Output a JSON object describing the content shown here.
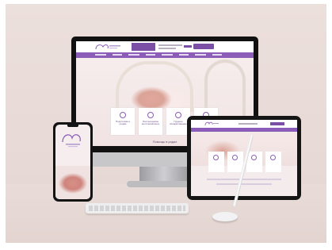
{
  "scene": "website mockup",
  "colors": {
    "wall": "#e8dbd7",
    "brand_purple": "#8b5db8",
    "device_black": "#111111"
  },
  "monitor": {
    "cards": [
      {
        "icon": "circle-icon",
        "label": "Подготовка к родам"
      },
      {
        "icon": "circle-icon",
        "label": "Послеродовое восстановление"
      },
      {
        "icon": "circle-icon",
        "label": "Грудное вскармливание"
      },
      {
        "icon": "circle-icon",
        "label": ""
      }
    ],
    "section_title": "Помощь в родах"
  },
  "tablet": {
    "cards": [
      {
        "icon": "circle-icon"
      },
      {
        "icon": "circle-icon"
      },
      {
        "icon": "circle-icon"
      },
      {
        "icon": "circle-icon"
      }
    ]
  }
}
